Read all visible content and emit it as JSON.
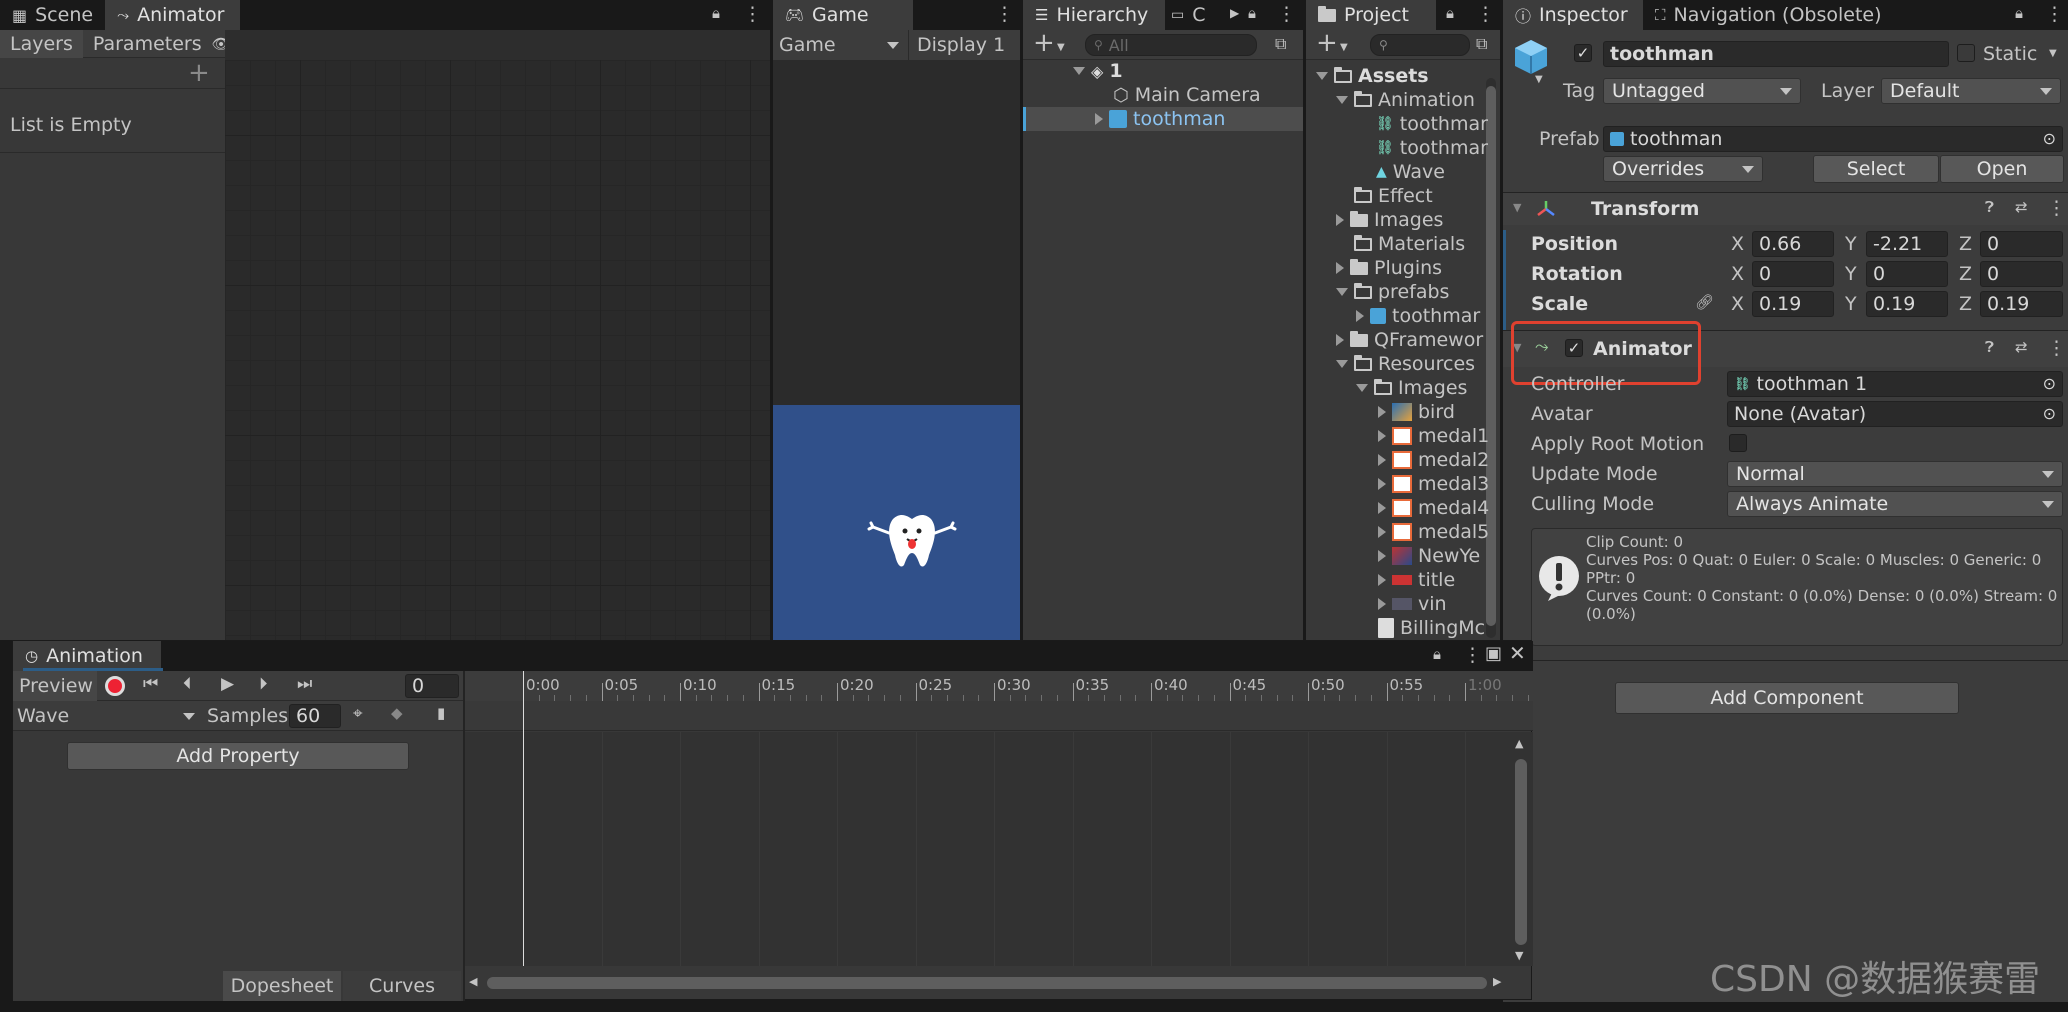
{
  "scene_tabs": {
    "scene": "Scene",
    "animator": "Animator"
  },
  "animator": {
    "sub_tabs": {
      "layers": "Layers",
      "parameters": "Parameters"
    },
    "empty_text": "List is Empty"
  },
  "game": {
    "tab": "Game",
    "mode_dropdown": "Game",
    "display_dropdown": "Display 1"
  },
  "hierarchy": {
    "tab": "Hierarchy",
    "second_tab": "C",
    "search_placeholder": "All",
    "scene_root": "1",
    "items": [
      "Main Camera",
      "toothman"
    ]
  },
  "project": {
    "tab": "Project",
    "tree": {
      "assets": "Assets",
      "animation": "Animation",
      "anim_children": [
        "toothmar",
        "toothmar",
        "Wave"
      ],
      "effect": "Effect",
      "images": "Images",
      "materials": "Materials",
      "plugins": "Plugins",
      "prefabs": "prefabs",
      "prefab_child": "toothmar",
      "qframework": "QFramewor",
      "resources": "Resources",
      "res_images": "Images",
      "res_images_children": [
        "bird",
        "medal1",
        "medal2",
        "medal3",
        "medal4",
        "medal5",
        "NewYe",
        "title",
        "vin"
      ],
      "billing": "BillingMc"
    }
  },
  "inspector": {
    "tab": "Inspector",
    "nav_tab": "Navigation (Obsolete)",
    "object_name": "toothman",
    "static_label": "Static",
    "tag_label": "Tag",
    "tag_value": "Untagged",
    "layer_label": "Layer",
    "layer_value": "Default",
    "prefab_label": "Prefab",
    "prefab_value": "toothman",
    "overrides": "Overrides",
    "select": "Select",
    "open": "Open",
    "transform": {
      "title": "Transform",
      "position_label": "Position",
      "rotation_label": "Rotation",
      "scale_label": "Scale",
      "position": {
        "x": "0.66",
        "y": "-2.21",
        "z": "0"
      },
      "rotation": {
        "x": "0",
        "y": "0",
        "z": "0"
      },
      "scale": {
        "x": "0.19",
        "y": "0.19",
        "z": "0.19"
      },
      "axis_x": "X",
      "axis_y": "Y",
      "axis_z": "Z"
    },
    "animator_comp": {
      "title": "Animator",
      "controller_label": "Controller",
      "controller_value": "toothman 1",
      "avatar_label": "Avatar",
      "avatar_value": "None (Avatar)",
      "apply_root_label": "Apply Root Motion",
      "update_mode_label": "Update Mode",
      "update_mode_value": "Normal",
      "culling_label": "Culling Mode",
      "culling_value": "Always Animate",
      "info_line1": "Clip Count: 0",
      "info_line2": "Curves Pos: 0 Quat: 0 Euler: 0 Scale: 0 Muscles: 0 Generic: 0",
      "info_line3": "PPtr: 0",
      "info_line4": "Curves Count: 0 Constant: 0 (0.0%) Dense: 0 (0.0%) Stream: 0",
      "info_line5": "(0.0%)"
    },
    "add_component": "Add Component"
  },
  "animation": {
    "tab": "Animation",
    "preview": "Preview",
    "frame_value": "0",
    "clip_value": "Wave",
    "samples_label": "Samples",
    "samples_value": "60",
    "add_property": "Add Property",
    "dopesheet": "Dopesheet",
    "curves": "Curves",
    "time_ticks": [
      "0:00",
      "0:05",
      "0:10",
      "0:15",
      "0:20",
      "0:25",
      "0:30",
      "0:35",
      "0:40",
      "0:45",
      "0:50",
      "0:55",
      "1:00"
    ]
  },
  "watermark": "CSDN @数据猴赛雷",
  "colors": {
    "highlight_box": "#e0412f",
    "game_bg": "#30508a",
    "selection": "#2c5d87"
  }
}
